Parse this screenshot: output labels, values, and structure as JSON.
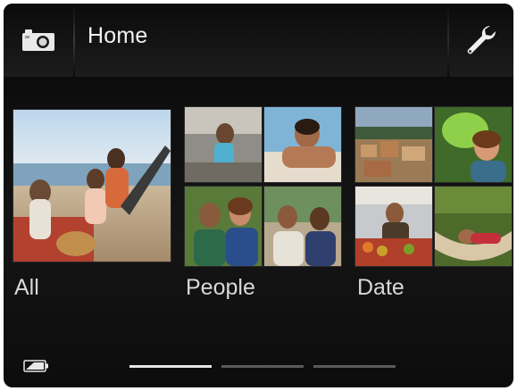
{
  "header": {
    "title": "Home",
    "left_icon": "camera-icon",
    "right_icon": "wrench-icon"
  },
  "albums": [
    {
      "label": "All"
    },
    {
      "label": "People"
    },
    {
      "label": "Date"
    }
  ],
  "status": {
    "battery_icon": "battery-icon"
  },
  "pager": {
    "page_count": 3,
    "active_index": 0
  },
  "colors": {
    "background": "#111111",
    "text": "#f2f2f2",
    "pager_active": "#e6e6e6",
    "pager_inactive": "#5a5a5a"
  }
}
